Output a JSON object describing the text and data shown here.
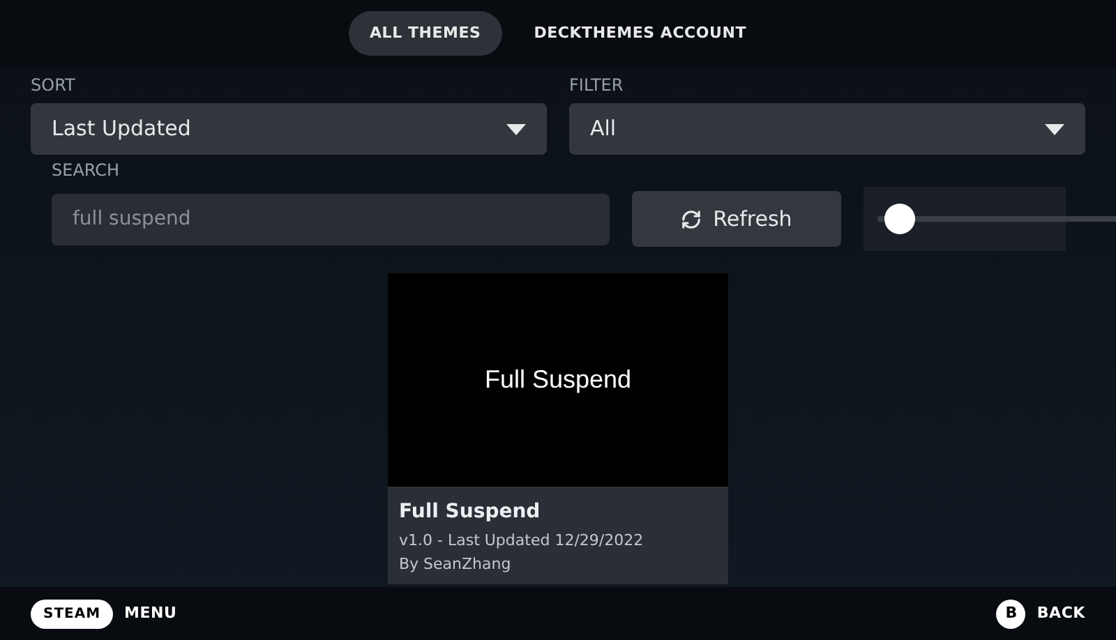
{
  "tabs": [
    {
      "label": "ALL THEMES",
      "selected": true
    },
    {
      "label": "DECKTHEMES ACCOUNT",
      "selected": false
    }
  ],
  "sort": {
    "label": "SORT",
    "value": "Last Updated"
  },
  "filter": {
    "label": "FILTER",
    "value": "All"
  },
  "search": {
    "label": "SEARCH",
    "value": "full suspend"
  },
  "refresh_button": "Refresh",
  "size_slider": {
    "level": 0.03
  },
  "themes": [
    {
      "preview_text": "Full Suspend",
      "name": "Full Suspend",
      "version": "v1.0 - Last Updated 12/29/2022",
      "author": "By SeanZhang"
    }
  ],
  "footer": {
    "left_badge": "STEAM",
    "left_label": "MENU",
    "right_badge": "B",
    "right_label": "BACK"
  }
}
